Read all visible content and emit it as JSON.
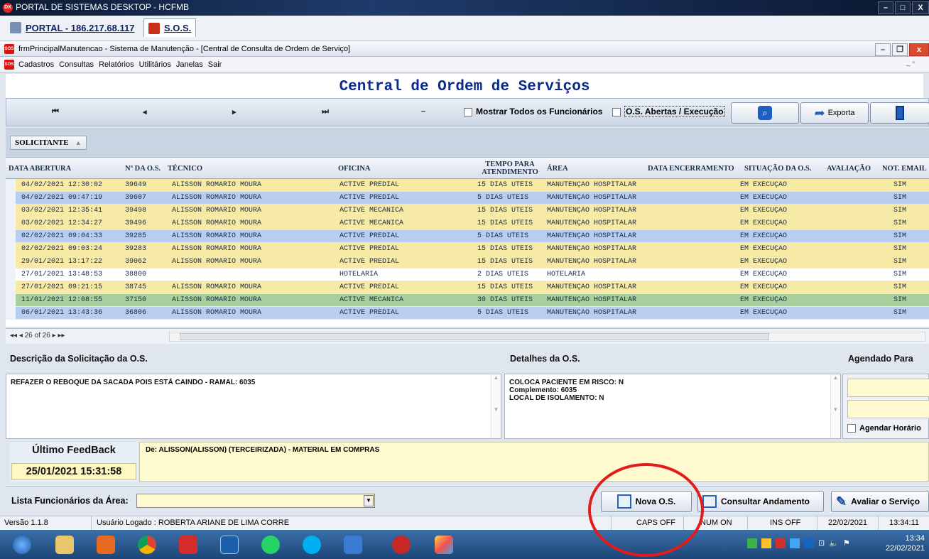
{
  "portal": {
    "title": "PORTAL DE SISTEMAS DESKTOP - HCFMB",
    "tab_portal": "PORTAL - 186.217.68.117",
    "tab_sos": "S.O.S."
  },
  "mdi": {
    "title": "frmPrincipalManutencao - Sistema de Manutenção - [Central de Consulta de Ordem de Serviço]"
  },
  "menu": [
    "Cadastros",
    "Consultas",
    "Relatórios",
    "Utilitários",
    "Janelas",
    "Sair"
  ],
  "header": {
    "title": "Central de Ordem de Serviços"
  },
  "toolbar": {
    "nav_first": "⏮",
    "nav_prev": "◂",
    "nav_next": "▸",
    "nav_last": "⏭",
    "nav_delete": "–",
    "show_all_label": "Mostrar Todos os Funcionários",
    "open_exec_label": "O.S. Abertas / Execução",
    "export_label": "Exporta"
  },
  "group": {
    "chip": "SOLICITANTE"
  },
  "columns": {
    "data_abertura": "DATA ABERTURA",
    "num_os": "Nº DA O.S.",
    "tecnico": "TÉCNICO",
    "oficina": "OFICINA",
    "tempo": "TEMPO PARA ATENDIMENTO",
    "area": "ÁREA",
    "data_enc": "DATA ENCERRAMENTO",
    "situacao": "SITUAÇÃO DA O.S.",
    "avaliacao": "AVALIAÇÃO",
    "not_email": "NOT. EMAIL"
  },
  "rows": [
    {
      "data": "04/02/2021 12:30:02",
      "os": "39649",
      "tecnico": "ALISSON ROMARIO MOURA",
      "oficina": "ACTIVE PREDIAL",
      "tempo": "15 DIAS ÚTEIS",
      "area": "MANUTENÇÃO HOSPITALAR",
      "enc": "",
      "situacao": "EM EXECUÇÃO",
      "aval": "",
      "email": "SIM",
      "color": "#f7e9a6"
    },
    {
      "data": "04/02/2021 09:47:19",
      "os": "39607",
      "tecnico": "ALISSON ROMARIO MOURA",
      "oficina": "ACTIVE PREDIAL",
      "tempo": "5 DIAS ÚTEIS",
      "area": "MANUTENÇÃO HOSPITALAR",
      "enc": "",
      "situacao": "EM EXECUÇÃO",
      "aval": "",
      "email": "SIM",
      "color": "#b9cdf0"
    },
    {
      "data": "03/02/2021 12:35:41",
      "os": "39498",
      "tecnico": "ALISSON ROMARIO MOURA",
      "oficina": "ACTIVE MECÂNICA",
      "tempo": "15 DIAS ÚTEIS",
      "area": "MANUTENÇÃO HOSPITALAR",
      "enc": "",
      "situacao": "EM EXECUÇÃO",
      "aval": "",
      "email": "SIM",
      "color": "#f7e9a6"
    },
    {
      "data": "03/02/2021 12:34:27",
      "os": "39496",
      "tecnico": "ALISSON ROMARIO MOURA",
      "oficina": "ACTIVE MECÂNICA",
      "tempo": "15 DIAS ÚTEIS",
      "area": "MANUTENÇÃO HOSPITALAR",
      "enc": "",
      "situacao": "EM EXECUÇÃO",
      "aval": "",
      "email": "SIM",
      "color": "#f7e9a6"
    },
    {
      "data": "02/02/2021 09:04:33",
      "os": "39285",
      "tecnico": "ALISSON ROMARIO MOURA",
      "oficina": "ACTIVE PREDIAL",
      "tempo": "5 DIAS ÚTEIS",
      "area": "MANUTENÇÃO HOSPITALAR",
      "enc": "",
      "situacao": "EM EXECUÇÃO",
      "aval": "",
      "email": "SIM",
      "color": "#b9cdf0"
    },
    {
      "data": "02/02/2021 09:03:24",
      "os": "39283",
      "tecnico": "ALISSON ROMARIO MOURA",
      "oficina": "ACTIVE PREDIAL",
      "tempo": "15 DIAS ÚTEIS",
      "area": "MANUTENÇÃO HOSPITALAR",
      "enc": "",
      "situacao": "EM EXECUÇÃO",
      "aval": "",
      "email": "SIM",
      "color": "#f7e9a6"
    },
    {
      "data": "29/01/2021 13:17:22",
      "os": "39062",
      "tecnico": "ALISSON ROMARIO MOURA",
      "oficina": "ACTIVE PREDIAL",
      "tempo": "15 DIAS ÚTEIS",
      "area": "MANUTENÇÃO HOSPITALAR",
      "enc": "",
      "situacao": "EM EXECUÇÃO",
      "aval": "",
      "email": "SIM",
      "color": "#f7e9a6"
    },
    {
      "data": "27/01/2021 13:48:53",
      "os": "38800",
      "tecnico": "",
      "oficina": "HOTELARIA",
      "tempo": "2 DIAS ÚTEIS",
      "area": "HOTELARIA",
      "enc": "",
      "situacao": "EM EXECUÇÃO",
      "aval": "",
      "email": "SIM",
      "color": "#ffffff"
    },
    {
      "data": "27/01/2021 09:21:15",
      "os": "38745",
      "tecnico": "ALISSON ROMARIO MOURA",
      "oficina": "ACTIVE PREDIAL",
      "tempo": "15 DIAS ÚTEIS",
      "area": "MANUTENÇÃO HOSPITALAR",
      "enc": "",
      "situacao": "EM EXECUÇÃO",
      "aval": "",
      "email": "SIM",
      "color": "#f7e9a6"
    },
    {
      "data": "11/01/2021 12:08:55",
      "os": "37150",
      "tecnico": "ALISSON ROMARIO MOURA",
      "oficina": "ACTIVE MECÂNICA",
      "tempo": "30 DIAS ÚTEIS",
      "area": "MANUTENÇÃO HOSPITALAR",
      "enc": "",
      "situacao": "EM EXECUÇÃO",
      "aval": "",
      "email": "SIM",
      "color": "#a9cf9f"
    },
    {
      "data": "06/01/2021 13:43:36",
      "os": "36806",
      "tecnico": "ALISSON ROMARIO MOURA",
      "oficina": "ACTIVE PREDIAL",
      "tempo": "5 DIAS ÚTEIS",
      "area": "MANUTENÇÃO HOSPITALAR",
      "enc": "",
      "situacao": "EM EXECUÇÃO",
      "aval": "",
      "email": "SIM",
      "color": "#b9cdf0"
    }
  ],
  "pager": {
    "text": "◂◂ ◂ 26 of 26 ▸ ▸▸"
  },
  "descricao": {
    "label": "Descrição da Solicitação da O.S.",
    "text": "REFAZER O REBOQUE DA SACADA POIS ESTÁ CAINDO - RAMAL: 6035"
  },
  "detalhes": {
    "label": "Detalhes da O.S.",
    "text": "COLOCA PACIENTE EM RISCO: N\nComplemento: 6035\nLOCAL DE ISOLAMENTO: N"
  },
  "agendado": {
    "label": "Agendado Para",
    "checkbox": "Agendar Horário"
  },
  "feedback": {
    "title": "Último FeedBack",
    "date": "25/01/2021 15:31:58",
    "text": "De: ALISSON(ALISSON) (TERCEIRIZADA) - MATERIAL EM COMPRAS"
  },
  "bottom": {
    "lista_label": "Lista Funcionários da Área:",
    "lista_value": "",
    "nova_os": "Nova O.S.",
    "consultar": "Consultar Andamento",
    "avaliar": "Avaliar o Serviço"
  },
  "status": {
    "versao": "Versão 1.1.8",
    "usuario": "Usuário Logado : ROBERTA ARIANE DE LIMA CORRE",
    "caps": "CAPS OFF",
    "num": "NUM ON",
    "ins": "INS OFF",
    "date": "22/02/2021",
    "time": "13:34:11"
  },
  "taskbar": {
    "clock_time": "13:34",
    "clock_date": "22/02/2021",
    "icons": [
      "start-orb-icon",
      "file-explorer-icon",
      "media-player-icon",
      "chrome-icon",
      "pdf-reader-icon",
      "chinese-ime-icon",
      "whatsapp-icon",
      "skype-icon",
      "document-icon",
      "dx-icon",
      "paint-icon"
    ]
  },
  "colors": {
    "accent_title": "#0b2a8a",
    "row_yellow": "#f7e9a6",
    "row_blue": "#b9cdf0",
    "row_green": "#a9cf9f",
    "highlight_circle": "#e31b1b"
  }
}
